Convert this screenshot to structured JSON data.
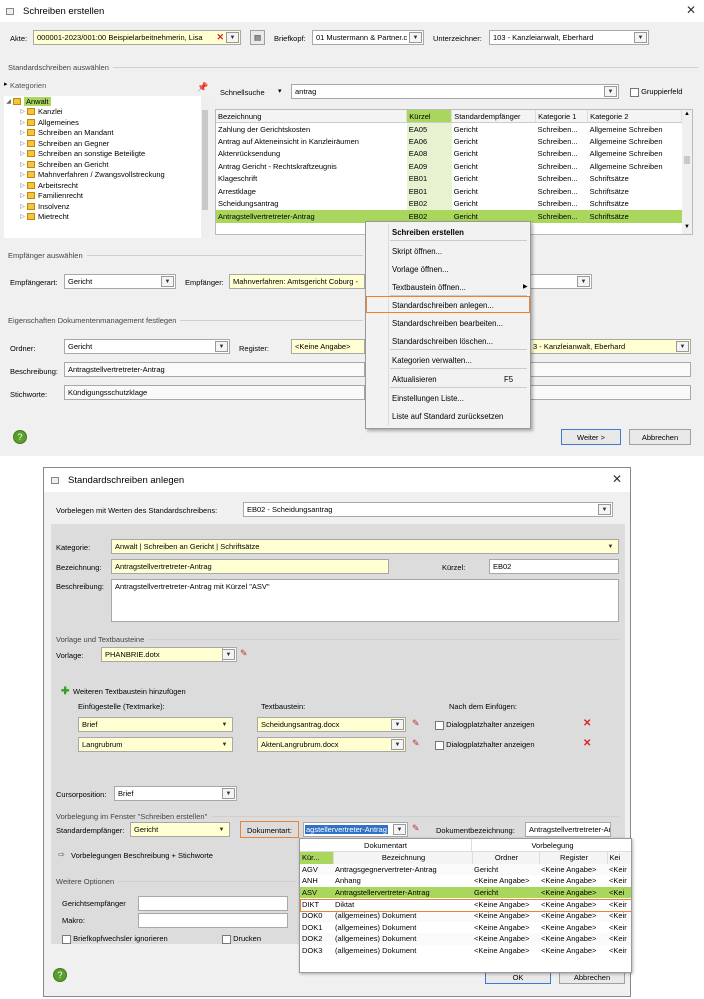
{
  "dialog1": {
    "title": "Schreiben erstellen",
    "akte_label": "Akte:",
    "akte_value": "000001-2023/001:00  Beispielarbeitnehmerin, Lisa",
    "briefkopf_label": "Briefkopf:",
    "briefkopf_value": "01 Mustermann & Partner.c",
    "unterzeichner_label": "Unterzeichner:",
    "unterzeichner_value": "103 - Kanzleianwalt, Eberhard",
    "section_standard": "Standardschreiben auswählen",
    "kategorien_label": "Kategorien",
    "tree_root": "Anwalt",
    "tree_items": [
      "Kanzlei",
      "Allgemeines",
      "Schreiben an Mandant",
      "Schreiben an Gegner",
      "Schreiben an sonstige Beteiligte",
      "Schreiben an Gericht",
      "Mahnverfahren / Zwangsvollstreckung",
      "Arbeitsrecht",
      "Familienrecht",
      "Insolvenz",
      "Mietrecht"
    ],
    "schnellsuche_label": "Schnellsuche",
    "schnellsuche_value": "antrag",
    "gruppierfeld_label": "Gruppierfeld",
    "columns": [
      "Bezeichnung",
      "Kürzel",
      "Standardempfänger",
      "Kategorie 1",
      "Kategorie 2"
    ],
    "rows": [
      [
        "Zahlung der Gerichtskosten",
        "EA05",
        "Gericht",
        "Schreiben...",
        "Allgemeine Schreiben"
      ],
      [
        "Antrag auf Akteneinsicht in Kanzleiräumen",
        "EA06",
        "Gericht",
        "Schreiben...",
        "Allgemeine Schreiben"
      ],
      [
        "Aktenrücksendung",
        "EA08",
        "Gericht",
        "Schreiben...",
        "Allgemeine Schreiben"
      ],
      [
        "Antrag Gericht - Rechtskraftzeugnis",
        "EA09",
        "Gericht",
        "Schreiben...",
        "Allgemeine Schreiben"
      ],
      [
        "Klageschrift",
        "EB01",
        "Gericht",
        "Schreiben...",
        "Schriftsätze"
      ],
      [
        "Arrestklage",
        "EB01",
        "Gericht",
        "Schreiben...",
        "Schriftsätze"
      ],
      [
        "Scheidungsantrag",
        "EB02",
        "Gericht",
        "Schreiben...",
        "Schriftsätze"
      ],
      [
        "Antragstellvertretreter-Antrag",
        "EB02",
        "Gericht",
        "Schreiben...",
        "Schriftsätze"
      ]
    ],
    "section_empfaenger": "Empfänger auswählen",
    "empfaengerart_label": "Empfängerart:",
    "empfaengerart_value": "Gericht",
    "empfaenger_label": "Empfänger:",
    "empfaenger_value": "Mahnverfahren: Amtsgericht Coburg -",
    "section_eigenschaften": "Eigenschaften Dokumentenmanagement festlegen",
    "ordner_label": "Ordner:",
    "ordner_value": "Gericht",
    "register_label": "Register:",
    "register_value": "<Keine Angabe>",
    "register2_value": "3 - Kanzleianwalt, Eberhard",
    "beschreibung_label": "Beschreibung:",
    "beschreibung_value": "Antragstellvertretreter-Antrag",
    "stichworte_label": "Stichworte:",
    "stichworte_value": "Kündigungsschutzklage",
    "weiter_label": "Weiter >",
    "abbrechen_label": "Abbrechen"
  },
  "context_menu": {
    "header": "Schreiben erstellen",
    "items": [
      "Skript öffnen...",
      "Vorlage öffnen...",
      "Textbaustein öffnen...",
      "Standardschreiben anlegen...",
      "Standardschreiben bearbeiten...",
      "Standardschreiben löschen...",
      "Kategorien verwalten...",
      "Aktualisieren",
      "Einstellungen Liste...",
      "Liste auf Standard zurücksetzen"
    ],
    "shortcut_aktualisieren": "F5"
  },
  "dialog2": {
    "title": "Standardschreiben anlegen",
    "vorbelegen_label": "Vorbelegen mit Werten des Standardschreibens:",
    "vorbelegen_value": "EB02 - Scheidungsantrag",
    "kategorie_label": "Kategorie:",
    "kategorie_value": "Anwalt | Schreiben an Gericht | Schriftsätze",
    "bezeichnung_label": "Bezeichnung:",
    "bezeichnung_value": "Antragstellvertretreter-Antrag",
    "kuerzel_label": "Kürzel:",
    "kuerzel_value": "EB02",
    "beschreibung_label": "Beschreibung:",
    "beschreibung_value": "Antragstellvertretreter-Antrag mit Kürzel \"ASV\"",
    "section_vorlage": "Vorlage und Textbausteine",
    "vorlage_label": "Vorlage:",
    "vorlage_value": "PHANBRIE.dotx",
    "add_tb_label": "Weiteren Textbaustein hinzufügen",
    "col_einfuege": "Einfügestelle (Textmarke):",
    "col_textbaustein": "Textbaustein:",
    "col_nach": "Nach dem Einfügen:",
    "tb_rows": [
      {
        "stelle": "Brief",
        "baustein": "Scheidungsantrag.docx",
        "option": "Dialogplatzhalter anzeigen"
      },
      {
        "stelle": "Langrubrum",
        "baustein": "AktenLangrubrum.docx",
        "option": "Dialogplatzhalter anzeigen"
      }
    ],
    "cursor_label": "Cursorposition:",
    "cursor_value": "Brief",
    "section_vorbelegung": "Vorbelegung im Fenster \"Schreiben erstellen\"",
    "stdempf_label": "Standardempfänger:",
    "stdempf_value": "Gericht",
    "dokart_label": "Dokumentart:",
    "dokart_value": "agstellervertreter-Antrag",
    "dokbez_label": "Dokumentbezeichnung:",
    "dokbez_value": "Antragstellvertretreter-Ar",
    "vorbelegungen_label": "Vorbelegungen Beschreibung + Stichworte",
    "section_weitere": "Weitere Optionen",
    "gerichtsempf_label": "Gerichtsempfänger",
    "makro_label": "Makro:",
    "briefkopf_label": "Briefkopfwechsler ignorieren",
    "drucken_label": "Drucken",
    "ok_label": "OK",
    "abbrechen_label": "Abbrechen"
  },
  "dropdown": {
    "group_dokumentart": "Dokumentart",
    "group_vorbelegung": "Vorbelegung",
    "columns": [
      "Kür...",
      "Bezeichnung",
      "Ordner",
      "Register",
      "Kei"
    ],
    "rows": [
      [
        "AGV",
        "Antragsgegnervertreter-Antrag",
        "Gericht",
        "<Keine Angabe>",
        "<Keir"
      ],
      [
        "ANH",
        "Anhang",
        "<Keine Angabe>",
        "<Keine Angabe>",
        "<Keir"
      ],
      [
        "ASV",
        "Antragstellervertreter-Antrag",
        "Gericht",
        "<Keine Angabe>",
        "<Kei"
      ],
      [
        "DIKT",
        "Diktat",
        "<Keine Angabe>",
        "<Keine Angabe>",
        "<Keir"
      ],
      [
        "DOK0",
        "(allgemeines) Dokument",
        "<Keine Angabe>",
        "<Keine Angabe>",
        "<Keir"
      ],
      [
        "DOK1",
        "(allgemeines) Dokument",
        "<Keine Angabe>",
        "<Keine Angabe>",
        "<Keir"
      ],
      [
        "DOK2",
        "(allgemeines) Dokument",
        "<Keine Angabe>",
        "<Keine Angabe>",
        "<Keir"
      ],
      [
        "DOK3",
        "(allgemeines) Dokument",
        "<Keine Angabe>",
        "<Keine Angabe>",
        "<Keir"
      ]
    ]
  },
  "colors": {
    "highlight_green": "#a9d65c",
    "orange": "#e8843a",
    "yellow_field": "#ffffd2"
  }
}
